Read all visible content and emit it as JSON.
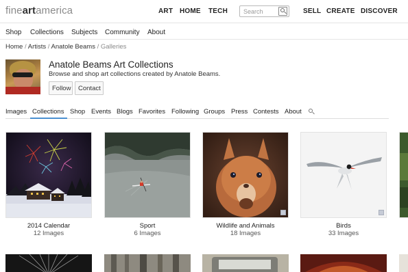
{
  "header": {
    "logo": {
      "part1": "fine",
      "part2": "art",
      "part3": "america"
    },
    "nav_left": [
      "ART",
      "HOME",
      "TECH"
    ],
    "search": {
      "placeholder": "Search",
      "value": ""
    },
    "nav_right": [
      "SELL",
      "CREATE",
      "DISCOVER"
    ]
  },
  "subnav": [
    "Shop",
    "Collections",
    "Subjects",
    "Community",
    "About"
  ],
  "breadcrumb": {
    "items": [
      "Home",
      "Artists",
      "Anatole Beams",
      "Galleries"
    ],
    "separator": "/"
  },
  "profile": {
    "title": "Anatole Beams Art Collections",
    "subtitle": "Browse and shop art collections created by Anatole Beams.",
    "follow_label": "Follow",
    "contact_label": "Contact"
  },
  "tabs": {
    "items": [
      "Images",
      "Collections",
      "Shop",
      "Events",
      "Blogs",
      "Favorites",
      "Following",
      "Groups",
      "Press",
      "Contests",
      "About"
    ],
    "active": "Collections"
  },
  "collections": [
    {
      "title": "2014 Calendar",
      "count": "12 Images"
    },
    {
      "title": "Sport",
      "count": "6 Images"
    },
    {
      "title": "Wildlife and Animals",
      "count": "18 Images"
    },
    {
      "title": "Birds",
      "count": "33 Images"
    }
  ],
  "colors": {
    "accent": "#4a8fd1",
    "text": "#222222",
    "muted": "#8a8a8a",
    "divider": "#e4e4e4"
  },
  "icons": {
    "search": "magnifier-icon",
    "tab_search": "magnifier-icon"
  }
}
